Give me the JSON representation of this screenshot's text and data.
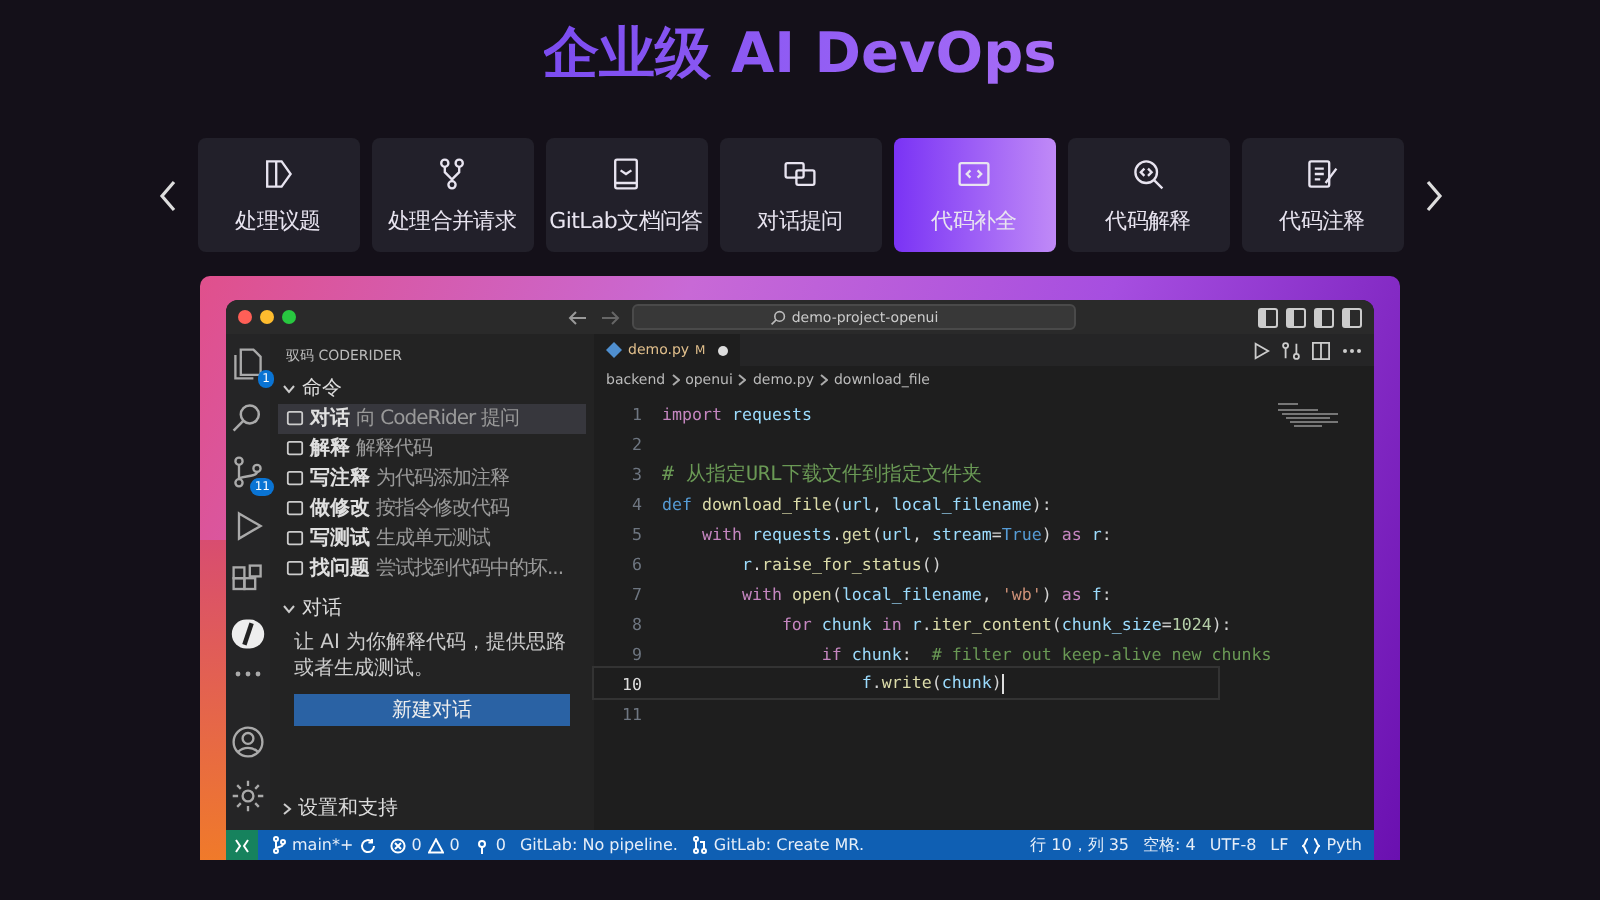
{
  "heading": "企业级 AI DevOps",
  "feature_tabs": [
    {
      "label": "处理议题",
      "selected": false
    },
    {
      "label": "处理合并请求",
      "selected": false
    },
    {
      "label": "GitLab文档问答",
      "selected": false
    },
    {
      "label": "对话提问",
      "selected": false
    },
    {
      "label": "代码补全",
      "selected": true
    },
    {
      "label": "代码解释",
      "selected": false
    },
    {
      "label": "代码注释",
      "selected": false
    }
  ],
  "editor_window": {
    "search": "demo-project-openui",
    "activity_badges": [
      "1",
      "11"
    ],
    "sidebar": {
      "title": "驭码 CODERIDER",
      "commands_header": "命令",
      "commands": [
        {
          "name": "对话",
          "hint": "向 CodeRider 提问",
          "selected": true
        },
        {
          "name": "解释",
          "hint": "解释代码",
          "selected": false
        },
        {
          "name": "写注释",
          "hint": "为代码添加注释",
          "selected": false
        },
        {
          "name": "做修改",
          "hint": "按指令修改代码",
          "selected": false
        },
        {
          "name": "写测试",
          "hint": "生成单元测试",
          "selected": false
        },
        {
          "name": "找问题",
          "hint": "尝试找到代码中的坏...",
          "selected": false
        }
      ],
      "chat_header": "对话",
      "chat_text": "让 AI 为你解释代码，提供思路或者生成测试。",
      "chat_button": "新建对话",
      "footer": "设置和支持"
    },
    "tab": {
      "name": "demo.py",
      "status": "M",
      "modified": true
    },
    "breadcrumb": [
      "backend",
      "openui",
      "demo.py",
      "download_file"
    ],
    "code": [
      {
        "n": "1",
        "current": false,
        "tokens": [
          {
            "t": "import",
            "kind": "control"
          },
          {
            "t": " requests",
            "kind": "variable"
          }
        ]
      },
      {
        "n": "2",
        "current": false
      },
      {
        "n": "3",
        "current": false,
        "tokens": [
          {
            "t": "# 从指定URL下载文件到指定文件夹",
            "kind": "comment"
          }
        ]
      },
      {
        "n": "4",
        "current": false,
        "tokens": [
          {
            "t": "def",
            "kind": "keyword"
          },
          {
            "t": " download_file",
            "kind": "function"
          },
          {
            "t": "(",
            "kind": "punct"
          },
          {
            "t": "url",
            "kind": "variable"
          },
          {
            "t": ", ",
            "kind": "punct"
          },
          {
            "t": "local_filename",
            "kind": "variable"
          },
          {
            "t": "):",
            "kind": "punct"
          }
        ]
      },
      {
        "n": "5",
        "current": false,
        "tokens": [
          {
            "t": "    with",
            "kind": "control"
          },
          {
            "t": " requests",
            "kind": "variable"
          },
          {
            "t": ".",
            "kind": "punct"
          },
          {
            "t": "get",
            "kind": "function"
          },
          {
            "t": "(",
            "kind": "punct"
          },
          {
            "t": "url",
            "kind": "variable"
          },
          {
            "t": ", ",
            "kind": "punct"
          },
          {
            "t": "stream",
            "kind": "variable"
          },
          {
            "t": "=",
            "kind": "punct"
          },
          {
            "t": "True",
            "kind": "keyword"
          },
          {
            "t": ") ",
            "kind": "punct"
          },
          {
            "t": "as",
            "kind": "control"
          },
          {
            "t": " r",
            "kind": "variable"
          },
          {
            "t": ":",
            "kind": "punct"
          }
        ]
      },
      {
        "n": "6",
        "current": false,
        "tokens": [
          {
            "t": "        r",
            "kind": "variable"
          },
          {
            "t": ".",
            "kind": "punct"
          },
          {
            "t": "raise_for_status",
            "kind": "function"
          },
          {
            "t": "()",
            "kind": "punct"
          }
        ]
      },
      {
        "n": "7",
        "current": false,
        "tokens": [
          {
            "t": "        with",
            "kind": "control"
          },
          {
            "t": " open",
            "kind": "function"
          },
          {
            "t": "(",
            "kind": "punct"
          },
          {
            "t": "local_filename",
            "kind": "variable"
          },
          {
            "t": ", ",
            "kind": "punct"
          },
          {
            "t": "'wb'",
            "kind": "string"
          },
          {
            "t": ") ",
            "kind": "punct"
          },
          {
            "t": "as",
            "kind": "control"
          },
          {
            "t": " f",
            "kind": "variable"
          },
          {
            "t": ":",
            "kind": "punct"
          }
        ]
      },
      {
        "n": "8",
        "current": false,
        "tokens": [
          {
            "t": "            for",
            "kind": "control"
          },
          {
            "t": " chunk",
            "kind": "variable"
          },
          {
            "t": " in",
            "kind": "control"
          },
          {
            "t": " r",
            "kind": "variable"
          },
          {
            "t": ".",
            "kind": "punct"
          },
          {
            "t": "iter_content",
            "kind": "function"
          },
          {
            "t": "(",
            "kind": "punct"
          },
          {
            "t": "chunk_size",
            "kind": "variable"
          },
          {
            "t": "=",
            "kind": "punct"
          },
          {
            "t": "1024",
            "kind": "number"
          },
          {
            "t": "):",
            "kind": "punct"
          }
        ]
      },
      {
        "n": "9",
        "current": false,
        "tokens": [
          {
            "t": "                if",
            "kind": "control"
          },
          {
            "t": " chunk",
            "kind": "variable"
          },
          {
            "t": ":  ",
            "kind": "punct"
          },
          {
            "t": "# filter out keep-alive new chunks",
            "kind": "comment"
          }
        ]
      },
      {
        "n": "10",
        "current": true,
        "tokens": [
          {
            "t": "                    f",
            "kind": "variable"
          },
          {
            "t": ".",
            "kind": "punct"
          },
          {
            "t": "write",
            "kind": "function"
          },
          {
            "t": "(",
            "kind": "punct"
          },
          {
            "t": "chunk",
            "kind": "variable"
          },
          {
            "t": ")",
            "kind": "punct"
          }
        ]
      },
      {
        "n": "11",
        "current": false
      }
    ],
    "status_bar": {
      "branch": "main*+",
      "errors": "0",
      "warnings": "0",
      "ports": "0",
      "pipeline": "GitLab: No pipeline.",
      "mr": "GitLab: Create MR.",
      "position": "行 10，列 35",
      "spaces": "空格: 4",
      "encoding": "UTF-8",
      "eol": "LF",
      "language": "Pyth"
    }
  }
}
